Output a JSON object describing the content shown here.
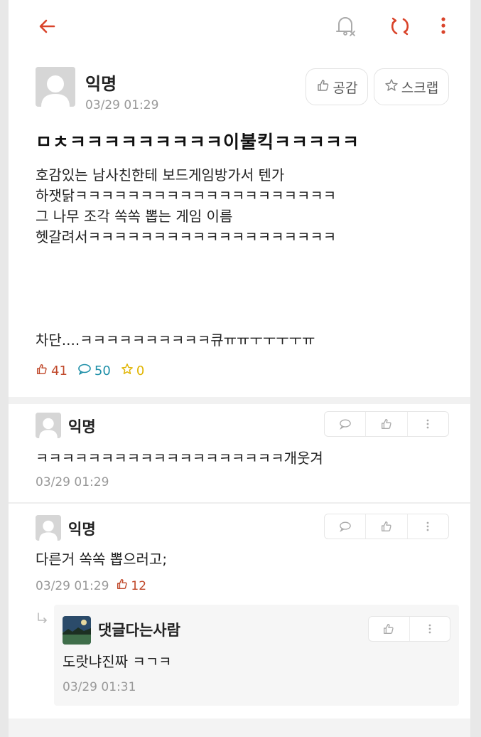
{
  "topbar": {
    "back_icon": "arrow-left-icon",
    "bell_icon": "bell-off-icon",
    "refresh_icon": "refresh-icon",
    "more_icon": "kebab-menu-icon",
    "accent": "#d9432a"
  },
  "post": {
    "author": "익명",
    "date": "03/29 01:29",
    "like_button": "공감",
    "scrap_button": "스크랩",
    "title": "ㅁㅊㅋㅋㅋㅋㅋㅋㅋㅋㅋ이불킥ㅋㅋㅋㅋㅋ",
    "body_lines": [
      "호감있는 남사친한테 보드게임방가서 텐가",
      "하잿닭ㅋㅋㅋㅋㅋㅋㅋㅋㅋㅋㅋㅋㅋㅋㅋㅋㅋㅋㅋㅋ",
      "그 나무 조각 쏙쏙 뽑는 게임 이름",
      "헷갈려서ㅋㅋㅋㅋㅋㅋㅋㅋㅋㅋㅋㅋㅋㅋㅋㅋㅋㅋㅋ"
    ],
    "tail": "차단....ㅋㅋㅋㅋㅋㅋㅋㅋㅋㅋ큐ㅠㅠㅜㅜㅜㅜㅠ",
    "stats": {
      "likes": "41",
      "comments": "50",
      "scraps": "0"
    }
  },
  "comments": [
    {
      "author": "익명",
      "text": "ㅋㅋㅋㅋㅋㅋㅋㅋㅋㅋㅋㅋㅋㅋㅋㅋㅋㅋㅋ개웃겨",
      "date": "03/29 01:29",
      "likes": ""
    },
    {
      "author": "익명",
      "text": "다른거 쏙쏙 뽑으러고;",
      "date": "03/29 01:29",
      "likes": "12"
    }
  ],
  "reply": {
    "author": "댓글다는사람",
    "text": "도랏냐진짜 ㅋㄱㅋ",
    "date": "03/29 01:31"
  },
  "colors": {
    "like": "#c0492b",
    "comment": "#1e8fa8",
    "scrap": "#e0b400",
    "muted": "#999999"
  }
}
